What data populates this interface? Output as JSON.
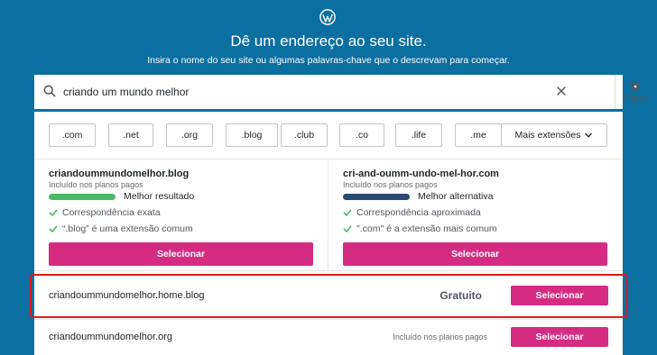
{
  "header": {
    "logo_icon": "wordpress-icon",
    "title": "Dê um endereço ao seu site.",
    "subtitle": "Insira o nome do seu site ou algumas palavras-chave que o descrevam para começar."
  },
  "search": {
    "value": "criando um mundo melhor",
    "filters_label": "Filtros"
  },
  "tlds": [
    ".com",
    ".net",
    ".org",
    ".blog",
    ".club",
    ".co",
    ".life",
    ".me"
  ],
  "more_extensions": "Mais extensões",
  "featured": [
    {
      "domain": "criandoummundomelhor.blog",
      "included": "Incluído nos planos pagos",
      "rank_label": "Melhor resultado",
      "rank_color": "#4ab866",
      "checks": [
        "Correspondência exata",
        "“.blog” é uma extensão comum"
      ],
      "select": "Selecionar"
    },
    {
      "domain": "cri-and-oumm-undo-mel-hor.com",
      "included": "Incluído nos planos pagos",
      "rank_label": "Melhor alternativa",
      "rank_color": "#2c4874",
      "checks": [
        "Correspondência aproximada",
        "\".com\" é a extensão mais comum"
      ],
      "select": "Selecionar"
    }
  ],
  "results": [
    {
      "domain": "criandoummundomelhor.home.blog",
      "price": "Gratuito",
      "select": "Selecionar"
    },
    {
      "domain": "criandoummundomelhor.org",
      "price": "Incluído nos planos pagos",
      "select": "Selecionar"
    }
  ],
  "colors": {
    "background": "#0b6fa1",
    "accent": "#d52c82",
    "check": "#4ab866",
    "highlight": "#e01919"
  }
}
